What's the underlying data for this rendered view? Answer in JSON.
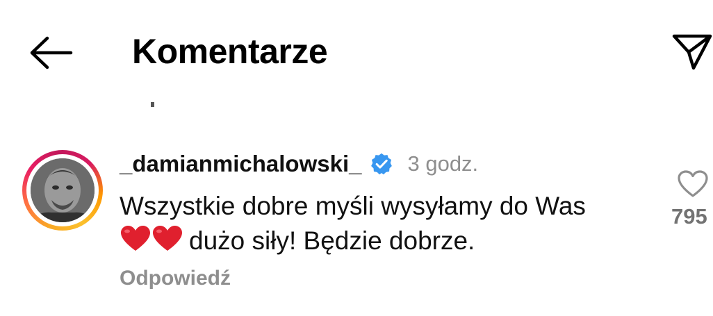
{
  "header": {
    "title": "Komentarze",
    "back_icon": "arrow-left-icon",
    "send_icon": "paper-plane-icon"
  },
  "comment": {
    "username": "_damianmichalowski_",
    "verified": true,
    "verified_color": "#3897f0",
    "time": "3 godz.",
    "text_line1": "Wszystkie dobre myśli wysyłamy do Was",
    "text_line2": "dużo siły! Będzie dobrze.",
    "emoji": "two-red-hearts",
    "reply_label": "Odpowiedź",
    "like_icon": "heart-outline-icon",
    "like_count": "795"
  },
  "colors": {
    "secondary_text": "#8e8e8e",
    "heart_red": "#e0202e"
  }
}
